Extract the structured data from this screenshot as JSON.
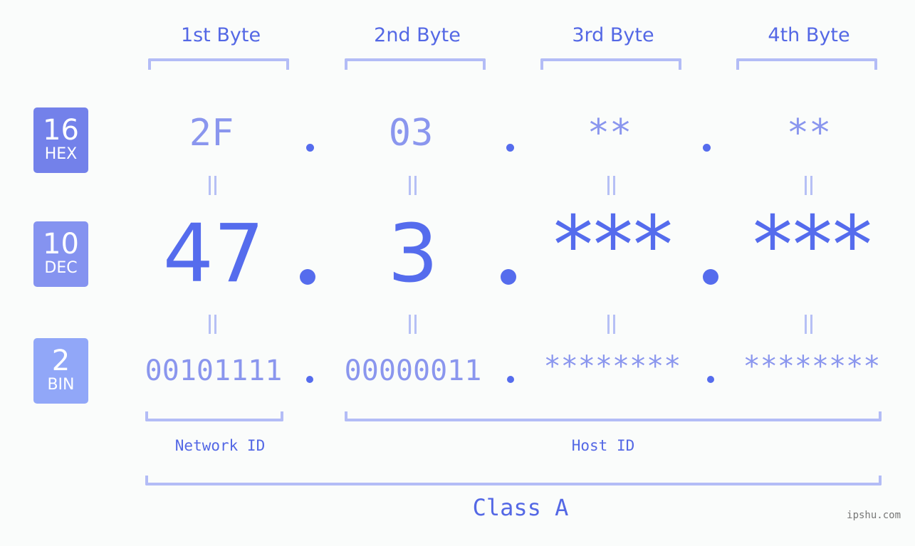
{
  "colors": {
    "accent": "#5468e5",
    "bracket": "#b3bcf6",
    "hex_badge": "#7381ea",
    "dec_badge": "#8593f0",
    "bin_badge": "#91a7f8",
    "muted_value": "#8a96ee",
    "strong_value": "#556ced"
  },
  "badges": [
    {
      "number": "16",
      "label": "HEX"
    },
    {
      "number": "10",
      "label": "DEC"
    },
    {
      "number": "2",
      "label": "BIN"
    }
  ],
  "byte_headers": [
    "1st Byte",
    "2nd Byte",
    "3rd Byte",
    "4th Byte"
  ],
  "hex": [
    "2F",
    "03",
    "**",
    "**"
  ],
  "dec": [
    "47",
    "3",
    "***",
    "***"
  ],
  "bin": [
    "00101111",
    "00000011",
    "********",
    "********"
  ],
  "separator": ".",
  "labels": {
    "network_id": "Network ID",
    "host_id": "Host ID",
    "class": "Class A"
  },
  "watermark": "ipshu.com"
}
